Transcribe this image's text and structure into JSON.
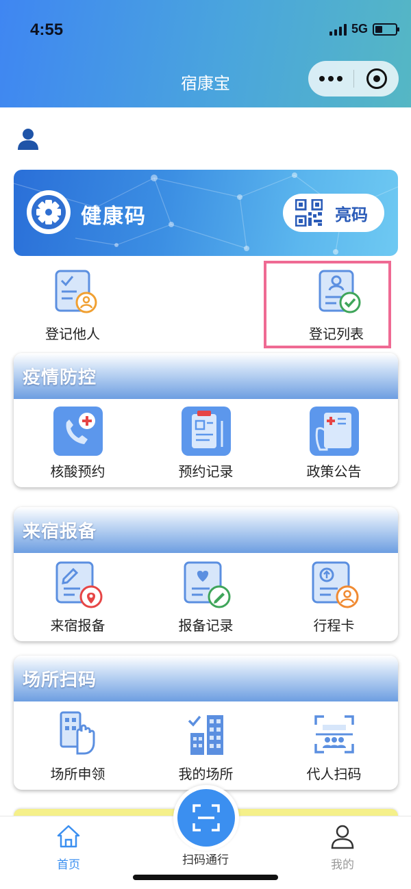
{
  "status_bar": {
    "time": "4:55",
    "network": "5G"
  },
  "nav": {
    "title": "宿康宝"
  },
  "health_banner": {
    "title": "健康码",
    "show_code_label": "亮码"
  },
  "quick_actions": [
    {
      "label": "登记他人",
      "icon": "register-others-icon"
    },
    {
      "label": "登记列表",
      "icon": "register-list-icon"
    }
  ],
  "sections": [
    {
      "title": "疫情防控",
      "items": [
        {
          "label": "核酸预约",
          "icon": "phone-medical-icon"
        },
        {
          "label": "预约记录",
          "icon": "clipboard-record-icon"
        },
        {
          "label": "政策公告",
          "icon": "policy-document-icon"
        }
      ]
    },
    {
      "title": "来宿报备",
      "items": [
        {
          "label": "来宿报备",
          "icon": "report-location-icon"
        },
        {
          "label": "报备记录",
          "icon": "report-record-icon"
        },
        {
          "label": "行程卡",
          "icon": "itinerary-card-icon"
        }
      ]
    },
    {
      "title": "场所扫码",
      "items": [
        {
          "label": "场所申领",
          "icon": "venue-apply-icon"
        },
        {
          "label": "我的场所",
          "icon": "my-venue-icon"
        },
        {
          "label": "代人扫码",
          "icon": "proxy-scan-icon"
        }
      ]
    }
  ],
  "tabbar": {
    "home_label": "首页",
    "scan_label": "扫码通行",
    "mine_label": "我的"
  },
  "colors": {
    "accent": "#3b8ff0",
    "highlight_border": "#ef6a93",
    "tab_active": "#3b8ff0",
    "tab_inactive": "#999999"
  }
}
